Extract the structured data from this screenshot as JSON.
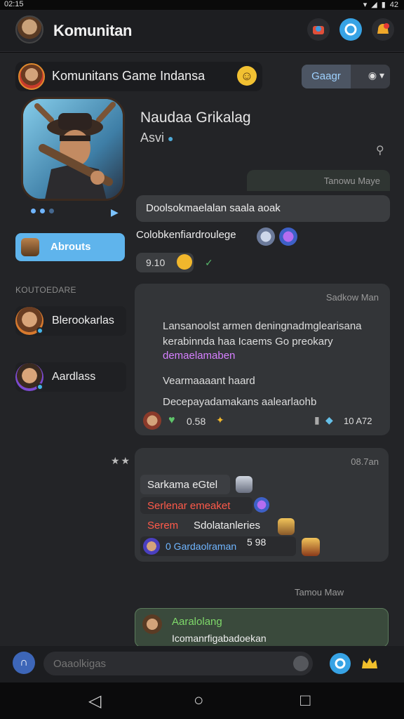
{
  "status_bar": {
    "time": "02:15",
    "battery": "42"
  },
  "app_bar": {
    "title": "Komunitan"
  },
  "group": {
    "name": "Komunitans Game Indansa",
    "action_label": "Gaagr"
  },
  "profile": {
    "name": "Naudaa Grikalag",
    "subtitle": "Asvi"
  },
  "messages": {
    "tag1": "Tanowu Maye",
    "msg1": "Doolsokmaelalan saala aoak",
    "msg2": "Colobkenfiardroulege",
    "msg3": "9.10"
  },
  "sidebar": {
    "button_label": "Abrouts",
    "section_label": "KOUTOEDARE",
    "members": [
      {
        "name": "Blerookarlas"
      },
      {
        "name": "Aardlass"
      }
    ]
  },
  "card_a": {
    "tag": "Sadkow Man",
    "line1": "Lansanoolst armen deningnadmglearisana kerabinnda haa Icaems Go preokary",
    "line2": "demaelamaben",
    "line3": "Vearmaaaant haard",
    "line4": "Decepayadamakans aalearlaohb",
    "foot_count": "0.58",
    "foot_time": "10 A72"
  },
  "card_b": {
    "tag": "08.7an",
    "row1": "Sarkama eGtel",
    "row2": "Serlenar emeaket",
    "row3a": "Serem",
    "row3b": "Sdolatanleries",
    "row4": "0 Gardaolraman",
    "row4_count": "5 98"
  },
  "card_c": {
    "tag": "Tamou Maw",
    "name": "Aaralolang",
    "text": "Icomanrfigabadoekan"
  },
  "composer": {
    "placeholder": "Oaaolkigas"
  },
  "colors": {
    "accent": "#5fb4ec",
    "background": "#232427"
  }
}
